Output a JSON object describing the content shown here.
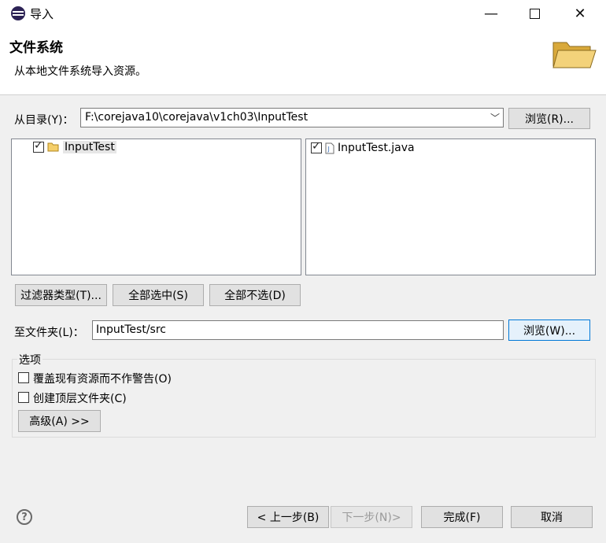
{
  "window": {
    "title": "导入",
    "controls": [
      "minimize-icon",
      "maximize-icon",
      "close-icon"
    ]
  },
  "header": {
    "title": "文件系统",
    "description": "从本地文件系统导入资源。",
    "icon": "folder-open-icon"
  },
  "from_dir": {
    "label": "从目录(Y)：",
    "value": "F:\\corejava10\\corejava\\v1ch03\\InputTest",
    "browse_label": "浏览(R)..."
  },
  "tree": {
    "items": [
      {
        "label": "InputTest",
        "checked": true,
        "icon": "folder-icon"
      }
    ]
  },
  "files": {
    "items": [
      {
        "label": "InputTest.java",
        "checked": true,
        "icon": "java-file-icon"
      }
    ]
  },
  "filter_buttons": {
    "filter_types": "过滤器类型(T)...",
    "select_all": "全部选中(S)",
    "deselect_all": "全部不选(D)"
  },
  "into_folder": {
    "label": "至文件夹(L)：",
    "value": "InputTest/src",
    "browse_label": "浏览(W)..."
  },
  "options": {
    "title": "选项",
    "overwrite": {
      "label": "覆盖现有资源而不作警告(O)",
      "checked": false
    },
    "create_top": {
      "label": "创建顶层文件夹(C)",
      "checked": false
    },
    "advanced": "高级(A) >>"
  },
  "footer": {
    "back": "< 上一步(B)",
    "next": "下一步(N)>",
    "finish": "完成(F)",
    "cancel": "取消"
  }
}
